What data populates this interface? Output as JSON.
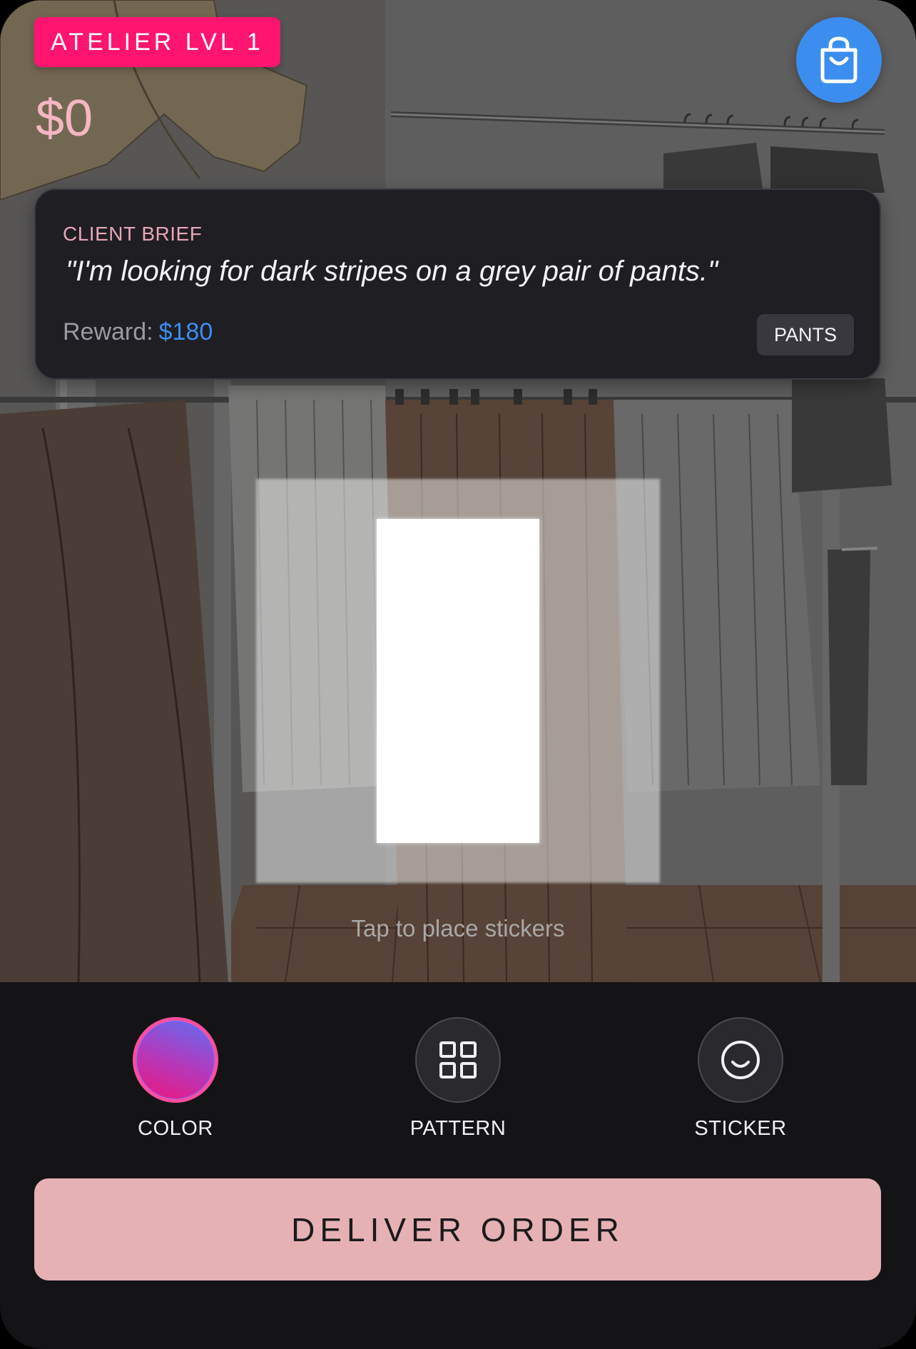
{
  "header": {
    "level_label": "ATELIER LVL 1",
    "balance": "$0"
  },
  "brief": {
    "heading": "CLIENT BRIEF",
    "quote": "\"I'm looking for dark stripes on a grey pair of pants.\"",
    "reward_label": "Reward:",
    "reward_amount": "$180",
    "category": "PANTS"
  },
  "canvas": {
    "hint": "Tap to place stickers"
  },
  "tools": [
    {
      "label": "COLOR",
      "icon": "color-swatch-icon"
    },
    {
      "label": "PATTERN",
      "icon": "grid-icon"
    },
    {
      "label": "STICKER",
      "icon": "smiley-icon"
    }
  ],
  "actions": {
    "deliver_label": "DELIVER ORDER"
  },
  "colors": {
    "level_badge": "#ff1470",
    "balance_text": "#f4b6c2",
    "bag_button": "#3b8ef0",
    "reward_amount": "#3b8ef0",
    "deliver_button": "#e6b1b5",
    "panel_background": "#141417",
    "card_background": "#1e1e23"
  }
}
